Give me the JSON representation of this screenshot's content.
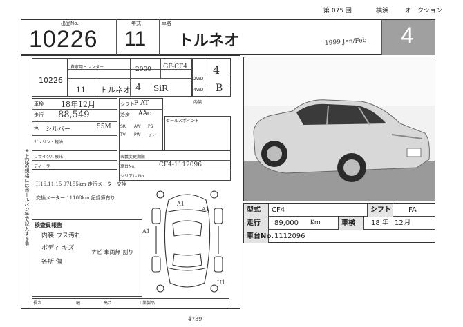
{
  "header": {
    "session": "第 075 回",
    "venue": "横浜",
    "auction": "オークション"
  },
  "top": {
    "lot_label": "出品No.",
    "lot_number": "10226",
    "year_label": "年式",
    "year": "11",
    "name_label": "車名",
    "car_name": "トルネオ",
    "grade_score": "4",
    "handwritten_year": "1999 Jan/Feb"
  },
  "form": {
    "stamp_lot": "10226",
    "type_label": "自家用・レンター",
    "cc": "2000",
    "model_code": "GF-CF4",
    "year_field": "11",
    "name_field": "トルネオ",
    "doors": "4",
    "grade": "SiR",
    "drive_labels": [
      "2WD",
      "4WD"
    ],
    "inner_label": "内装",
    "inner_value": "B",
    "outer_score": "4",
    "inspection_label": "車検",
    "inspection_value": "18年12月",
    "mileage_label": "走行",
    "mileage_value": "88,549",
    "color_label": "色",
    "color_value": "シルバー",
    "color_code": "55M",
    "fuel_label": "ガソリン・軽油",
    "shift_label": "シフト",
    "shift_value": "F AT",
    "ac_label": "冷房",
    "ac_value": "AAc",
    "equip_labels": [
      "SR",
      "AW",
      "PS",
      "TV",
      "PW",
      "ナビ"
    ],
    "sales_point_label": "セールスポイント",
    "recycle_label": "リサイクル預託",
    "registration_label": "名義変更期限",
    "dealer_label": "ディーラー",
    "frame_label": "車台No.",
    "frame_value": "CF4-1112096",
    "mitsu_label": "シリアル No.",
    "handwritten_notes": [
      "H16.11.15 97155km 走行メーター交換",
      "交換メーター 11108km 記録簿有り"
    ],
    "report_title": "検査員報告",
    "report_lines": [
      "内装 ウス汚れ",
      "ボディ キズ",
      "各所 傷",
      "ナビ 車両無 割り"
    ],
    "footer_labels": [
      "長さ",
      "幅",
      "高さ",
      "工業製品"
    ],
    "side_note": "※上記の規格にはボールペン等で記入する事",
    "bottom_note": "4739"
  },
  "specs": {
    "type_label": "型式",
    "type_value": "CF4",
    "shift_label": "シフト",
    "shift_value": "FA",
    "mileage_label": "走行",
    "mileage_value": "89,000",
    "mileage_unit": "Km",
    "inspection_label": "車検",
    "inspection_year": "18",
    "year_unit": "年",
    "inspection_month": "12",
    "month_unit": "月",
    "frame_label": "車台No.",
    "frame_value": "1112096"
  },
  "diagram": {
    "marks": [
      "A1",
      "A1",
      "A1",
      "U1"
    ]
  },
  "colors": {
    "score_bg": "#a0a0a0",
    "label_bg": "#e4e4e4",
    "line": "#333333"
  }
}
